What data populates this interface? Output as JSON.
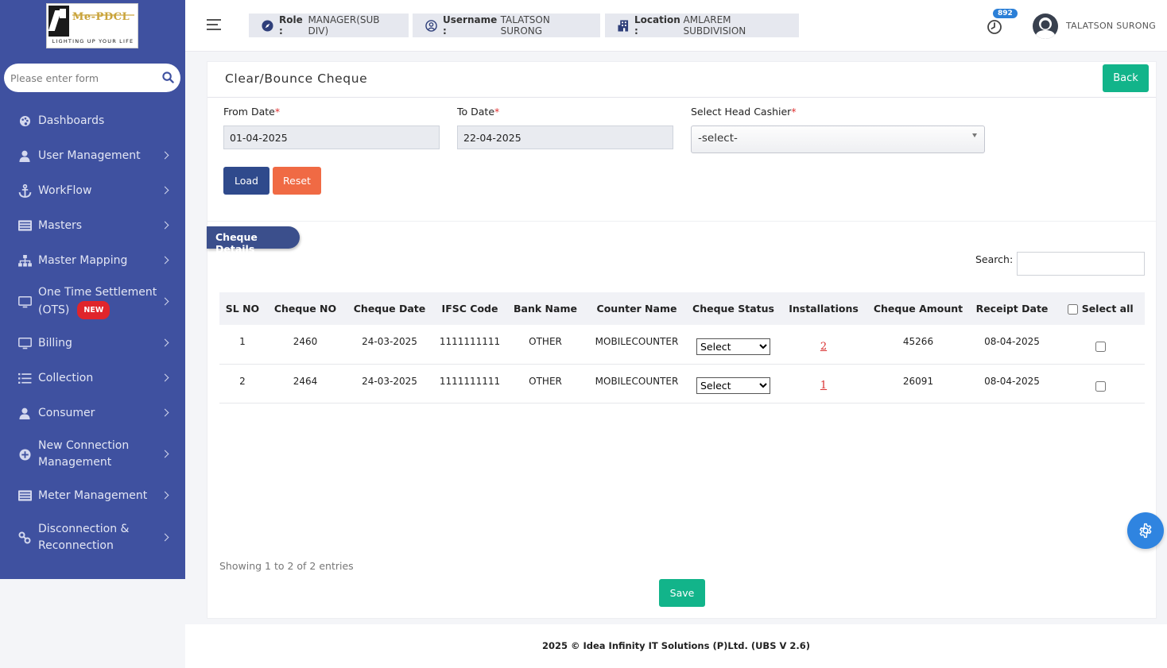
{
  "brand": {
    "logo_text": "Me-PDCL",
    "tagline": "LIGHTING UP YOUR LIFE"
  },
  "sidebar": {
    "search_placeholder": "Please enter form",
    "items": [
      {
        "label": "Dashboards",
        "icon": "palette-icon",
        "has_children": false
      },
      {
        "label": "User Management",
        "icon": "user-icon",
        "has_children": true
      },
      {
        "label": "WorkFlow",
        "icon": "anchor-icon",
        "has_children": true
      },
      {
        "label": "Masters",
        "icon": "list-box-icon",
        "has_children": true
      },
      {
        "label": "Master Mapping",
        "icon": "sitemap-icon",
        "has_children": true
      },
      {
        "label": "One Time Settlement (OTS)",
        "icon": "monitor-icon",
        "has_children": true,
        "badge": "NEW"
      },
      {
        "label": "Billing",
        "icon": "monitor-icon",
        "has_children": true
      },
      {
        "label": "Collection",
        "icon": "list-icon",
        "has_children": true
      },
      {
        "label": "Consumer",
        "icon": "user-icon",
        "has_children": true
      },
      {
        "label": "New Connection Management",
        "icon": "plus-circle-icon",
        "has_children": true
      },
      {
        "label": "Meter Management",
        "icon": "list-box-icon",
        "has_children": true
      },
      {
        "label": "Disconnection & Reconnection",
        "icon": "link-icon",
        "has_children": true
      }
    ]
  },
  "header": {
    "role_label": "Role :",
    "role_value": "MANAGER(SUB DIV)",
    "username_label": "Username :",
    "username_value": "TALATSON SURONG",
    "location_label": "Location :",
    "location_value": "AMLAREM SUBDIVISION",
    "notification_count": "892",
    "user_display_name": "TALATSON SURONG"
  },
  "page": {
    "title": "Clear/Bounce Cheque",
    "back_label": "Back"
  },
  "form": {
    "from_date_label": "From Date",
    "from_date_value": "01-04-2025",
    "to_date_label": "To Date",
    "to_date_value": "22-04-2025",
    "head_cashier_label": "Select Head Cashier",
    "head_cashier_value": "-select-",
    "required_mark": "*",
    "load_label": "Load",
    "reset_label": "Reset"
  },
  "cheque_section": {
    "title": "Cheque Details",
    "search_label": "Search:",
    "columns": [
      "SL NO",
      "Cheque NO",
      "Cheque Date",
      "IFSC Code",
      "Bank Name",
      "Counter Name",
      "Cheque Status",
      "Installations",
      "Cheque Amount",
      "Receipt Date"
    ],
    "select_all_label": "Select all",
    "rows": [
      {
        "sl": "1",
        "cheque_no": "2460",
        "cheque_date": "24-03-2025",
        "ifsc": "1111111111",
        "bank": "OTHER",
        "counter": "MOBILECOUNTER",
        "status": "Select",
        "installations": "2",
        "amount": "45266",
        "receipt_date": "08-04-2025"
      },
      {
        "sl": "2",
        "cheque_no": "2464",
        "cheque_date": "24-03-2025",
        "ifsc": "1111111111",
        "bank": "OTHER",
        "counter": "MOBILECOUNTER",
        "status": "Select",
        "installations": "1",
        "amount": "26091",
        "receipt_date": "08-04-2025"
      }
    ],
    "showing_text": "Showing 1 to 2 of 2 entries",
    "save_label": "Save"
  },
  "footer": {
    "text": "2025 © Idea Infinity IT Solutions (P)Ltd. (UBS V 2.6)"
  },
  "colors": {
    "sidebar_bg": "#3f51a0",
    "primary_dark": "#2f4a8c",
    "success": "#12b48a",
    "danger_orange": "#f06a44",
    "badge_red": "#e0252b",
    "notify_blue": "#2b7fd7"
  }
}
